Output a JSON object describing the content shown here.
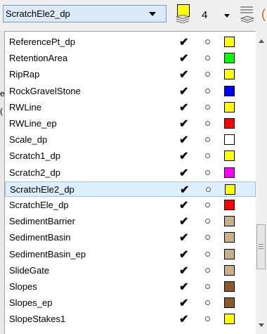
{
  "toolbar": {
    "active_level": "ScratchEle2_dp",
    "count": "4",
    "active_color": "#ffff00"
  },
  "list": {
    "selected_index": 10,
    "items": [
      {
        "name": "ReferencePt_dp",
        "check": "✔",
        "color": "#ffff00"
      },
      {
        "name": "RetentionArea",
        "check": "✔",
        "color": "#00ff00"
      },
      {
        "name": "RipRap",
        "check": "✔",
        "color": "#ffff00"
      },
      {
        "name": "RockGravelStone",
        "check": "✔",
        "color": "#0000ff"
      },
      {
        "name": "RWLine",
        "check": "✔",
        "color": "#ffff00"
      },
      {
        "name": "RWLine_ep",
        "check": "✔",
        "color": "#ff0000"
      },
      {
        "name": "Scale_dp",
        "check": "✔",
        "color": "#ffffff"
      },
      {
        "name": "Scratch1_dp",
        "check": "✔",
        "color": "#ffff00"
      },
      {
        "name": "Scratch2_dp",
        "check": "✔",
        "color": "#ff00ff"
      },
      {
        "name": "ScratchEle2_dp",
        "check": "✔",
        "color": "#ffff00"
      },
      {
        "name": "ScratchEle_dp",
        "check": "✔",
        "color": "#ff0000"
      },
      {
        "name": "SedimentBarrier",
        "check": "✔",
        "color": "#c8b08a"
      },
      {
        "name": "SedimentBasin",
        "check": "✔",
        "color": "#c8b08a"
      },
      {
        "name": "SedimentBasin_ep",
        "check": "✔",
        "color": "#c8b08a"
      },
      {
        "name": "SlideGate",
        "check": "✔",
        "color": "#c8b08a"
      },
      {
        "name": "Slopes",
        "check": "✔",
        "color": "#8b5a2b"
      },
      {
        "name": "Slopes_ep",
        "check": "✔",
        "color": "#8b5a2b"
      },
      {
        "name": "SlopeStakes1",
        "check": "✔",
        "color": "#ffff00"
      }
    ]
  },
  "left_strip": {
    "glyph1": "e",
    "glyph2": "("
  }
}
